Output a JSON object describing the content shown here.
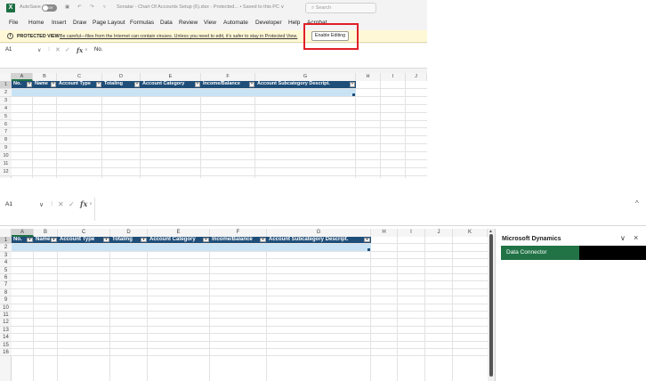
{
  "top_window": {
    "autosave_label": "AutoSave",
    "autosave_state": "Off",
    "title": "Sonatar - Chart Of Accounts Setup (6).xlsx  -  Protected...  •  Saved to this PC ∨",
    "search_placeholder": "Search",
    "menu": [
      "File",
      "Home",
      "Insert",
      "Draw",
      "Page Layout",
      "Formulas",
      "Data",
      "Review",
      "View",
      "Automate",
      "Developer",
      "Help",
      "Acrobat"
    ],
    "protected_view": {
      "icon": "info-icon",
      "title": "PROTECTED VIEW",
      "message": "Be careful—files from the Internet can contain viruses. Unless you need to edit, it's safer to stay in Protected View.",
      "button": "Enable Editing"
    },
    "name_box": "A1",
    "formula_value": "No.",
    "fx_label": "fx"
  },
  "table": {
    "headers": [
      "No.",
      "Name",
      "Account Type",
      "Totaling",
      "Account Category",
      "Income/Balance",
      "Account Subcategory Descript."
    ],
    "dropdown_glyph": "▼"
  },
  "grid_top": {
    "columns": [
      "A",
      "B",
      "C",
      "D",
      "E",
      "F",
      "G",
      "H",
      "I",
      "J"
    ],
    "rows": [
      "1",
      "2",
      "3",
      "4",
      "5",
      "6",
      "7",
      "8",
      "9",
      "10",
      "11",
      "12"
    ]
  },
  "bottom_window": {
    "name_box": "A1",
    "formula_value": "",
    "fx_label": "fx",
    "columns": [
      "A",
      "B",
      "C",
      "D",
      "E",
      "F",
      "G",
      "H",
      "I",
      "J",
      "K"
    ],
    "rows": [
      "1",
      "2",
      "3",
      "4",
      "5",
      "6",
      "7",
      "8",
      "9",
      "10",
      "11",
      "12",
      "13",
      "14",
      "15",
      "16"
    ],
    "side_pane": {
      "title": "Microsoft Dynamics",
      "tab": "Data Connector"
    }
  },
  "colors": {
    "table_header": "#1f4e79",
    "selected_row": "#c9e3f5",
    "excel_green": "#217346",
    "protected_bar": "#fff8d6",
    "highlight_red": "#e01f26"
  }
}
